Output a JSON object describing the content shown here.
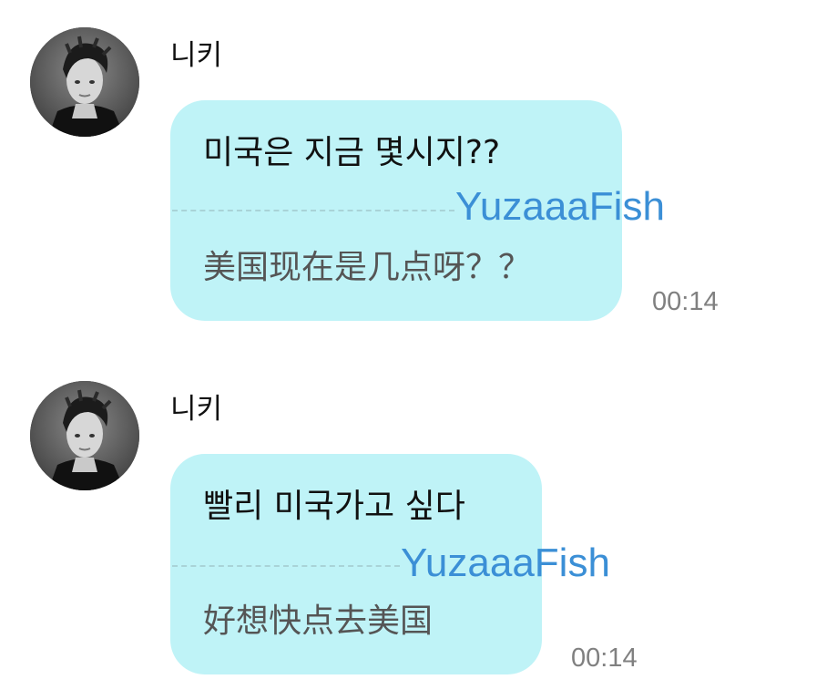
{
  "chat": {
    "messages": [
      {
        "sender": "니키",
        "avatar_icon": "profile-photo-icon",
        "korean": "미국은 지금 몇시지??",
        "chinese": "美国现在是几点呀？？",
        "watermark": "YuzaaaFish",
        "time": "00:14"
      },
      {
        "sender": "니키",
        "avatar_icon": "profile-photo-icon",
        "korean": "빨리 미국가고 싶다",
        "chinese": "好想快点去美国",
        "watermark": "YuzaaaFish",
        "time": "00:14"
      }
    ]
  },
  "colors": {
    "bubble": "#bff3f7",
    "watermark": "#3b8fd6",
    "time": "#808080",
    "translation": "#555555"
  }
}
